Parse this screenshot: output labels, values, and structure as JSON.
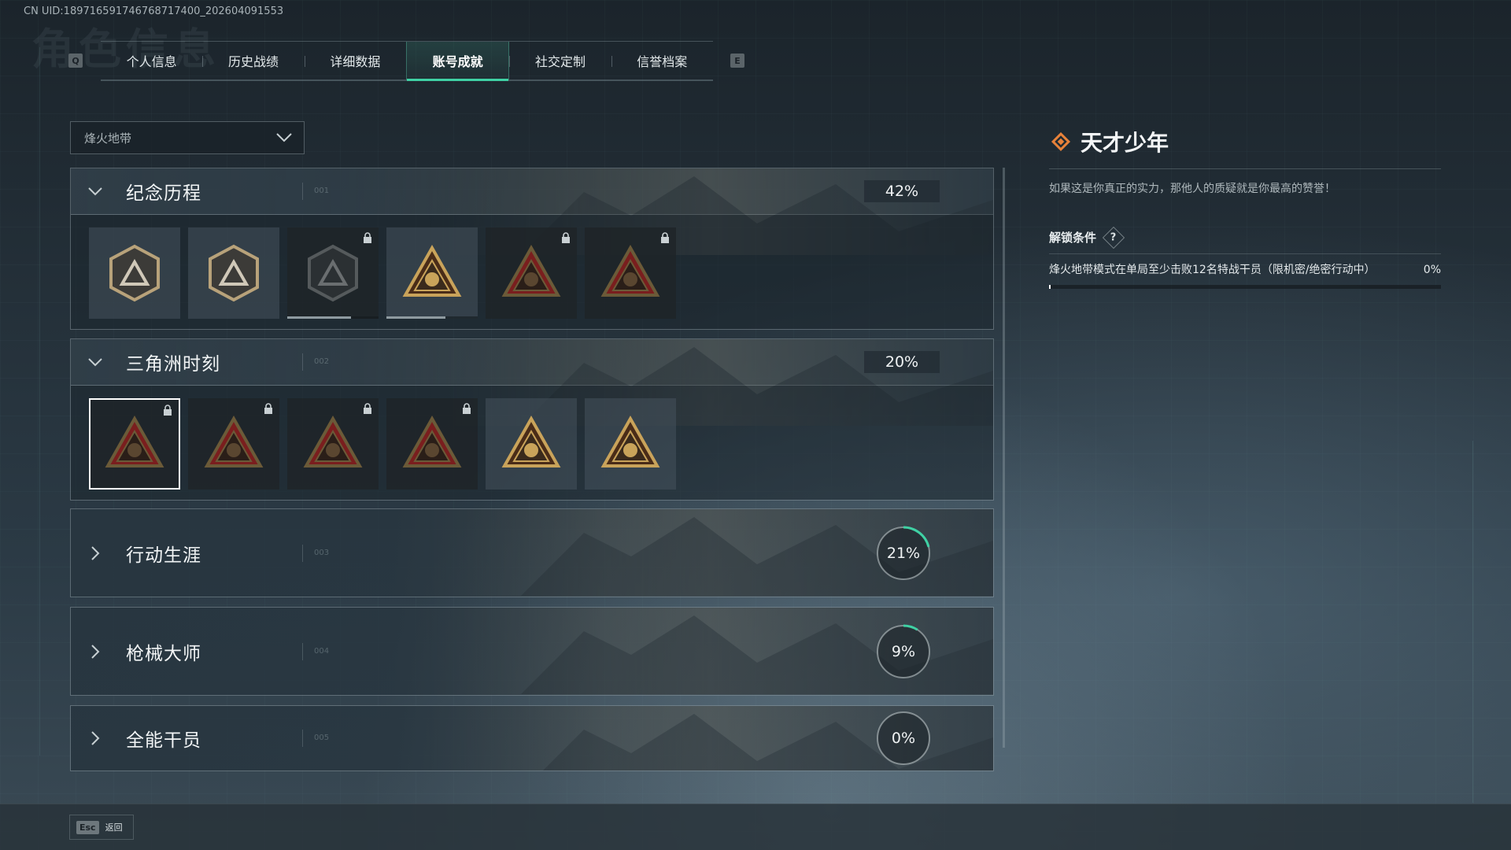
{
  "uid_text": "CN UID:1897165917467687174​00_202604091553",
  "ghost_title": "角色信息",
  "keys": {
    "prev": "Q",
    "next": "E"
  },
  "tabs": [
    {
      "label": "个人信息",
      "active": false
    },
    {
      "label": "历史战绩",
      "active": false
    },
    {
      "label": "详细数据",
      "active": false
    },
    {
      "label": "账号成就",
      "active": true
    },
    {
      "label": "社交定制",
      "active": false
    },
    {
      "label": "信誉档案",
      "active": false
    }
  ],
  "mode_select": {
    "value": "烽火地带"
  },
  "categories": [
    {
      "title": "纪念历程",
      "index": "001",
      "progress": "42%",
      "progress_value": 0.42,
      "expanded": true,
      "badges": [
        {
          "icon": "triangle-shield-emblem",
          "locked": false,
          "dark": false
        },
        {
          "icon": "helicopter-emblem",
          "locked": false,
          "dark": false
        },
        {
          "icon": "dark-shield-emblem",
          "locked": true,
          "dark": true,
          "bar": 0.7
        },
        {
          "icon": "fire-truck-58-emblem",
          "locked": false,
          "dark": false,
          "bar": 0.65
        },
        {
          "icon": "masked-operator-emblem",
          "locked": true,
          "dark": true
        },
        {
          "icon": "skull-crossbones-emblem",
          "locked": true,
          "dark": true
        }
      ]
    },
    {
      "title": "三角洲时刻",
      "index": "002",
      "progress": "20%",
      "progress_value": 0.2,
      "expanded": true,
      "badges": [
        {
          "icon": "robot-triangle-emblem",
          "locked": true,
          "dark": true,
          "selected": true
        },
        {
          "icon": "mask-triangle-emblem",
          "locked": true,
          "dark": true
        },
        {
          "icon": "seated-figure-emblem",
          "locked": true,
          "dark": true
        },
        {
          "icon": "fist-triangle-emblem",
          "locked": true,
          "dark": true
        },
        {
          "icon": "squad-triangle-emblem",
          "locked": false,
          "dark": false
        },
        {
          "icon": "rocket-triangle-emblem",
          "locked": false,
          "dark": false
        }
      ]
    },
    {
      "title": "行动生涯",
      "index": "003",
      "progress": "21%",
      "progress_value": 0.21,
      "expanded": false
    },
    {
      "title": "枪械大师",
      "index": "004",
      "progress": "9%",
      "progress_value": 0.09,
      "expanded": false
    },
    {
      "title": "全能干员",
      "index": "005",
      "progress": "0%",
      "progress_value": 0.0,
      "expanded": false
    }
  ],
  "detail": {
    "title": "天才少年",
    "description": "如果这是你真正的实力，那他人的质疑就是你最高的赞誉！",
    "unlock_label": "解锁条件",
    "help_icon": "?",
    "condition_text": "烽火地带模式在单局至少击败12名特战干员（限机密/绝密行动中）",
    "condition_progress": "0%",
    "condition_value": 0.0
  },
  "footer": {
    "esc_key": "Esc",
    "back_label": "返回"
  },
  "colors": {
    "accent": "#3fd1a4",
    "title_icon": "#e8823a",
    "badge_gold": "#c9a35a",
    "badge_red": "#7a1e1e"
  }
}
